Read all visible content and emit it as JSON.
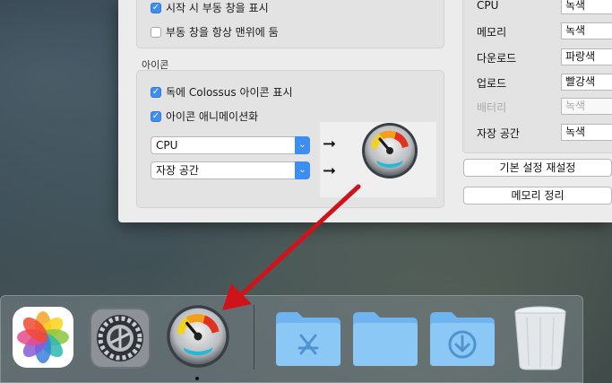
{
  "prefs": {
    "float_group": {
      "show_floating": "시작 시 부동 창을 표시",
      "always_on_top": "부동 창을 항상 맨위에 둠"
    },
    "icon_section": {
      "title": "아이콘",
      "show_in_dock": "독에 Colossus 아이콘 표시",
      "animate_icon": "아이콘 애니메이션화",
      "select_top": "CPU",
      "select_bottom": "자장 공간"
    },
    "colors": {
      "rows": [
        {
          "label": "CPU",
          "value": "녹색"
        },
        {
          "label": "메모리",
          "value": "녹색"
        },
        {
          "label": "다운로드",
          "value": "파랑색"
        },
        {
          "label": "업로드",
          "value": "빨강색"
        },
        {
          "label": "배터리",
          "value": "녹색"
        },
        {
          "label": "자장 공간",
          "value": "녹색"
        }
      ]
    },
    "buttons": {
      "reset": "기본 설정 재설정",
      "purge": "메모리 정리"
    }
  },
  "dock": {
    "items": [
      "photos-icon",
      "system-preferences-icon",
      "colossus-icon",
      "applications-folder-icon",
      "documents-folder-icon",
      "downloads-folder-icon",
      "trash-icon"
    ]
  },
  "accent_color": "#3d8ef0",
  "annotation_color": "#d0121b"
}
